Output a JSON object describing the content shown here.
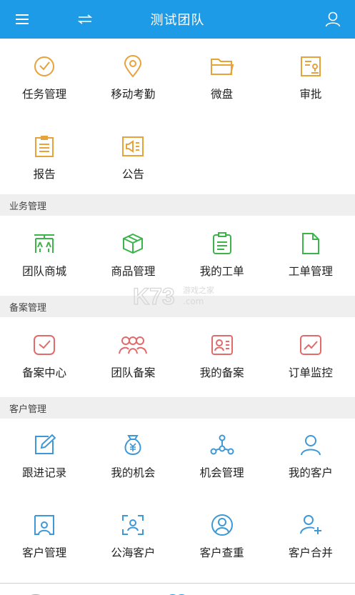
{
  "header": {
    "title": "测试团队"
  },
  "top_items": [
    {
      "label": "任务管理"
    },
    {
      "label": "移动考勤"
    },
    {
      "label": "微盘"
    },
    {
      "label": "审批"
    },
    {
      "label": "报告"
    },
    {
      "label": "公告"
    }
  ],
  "sections": [
    {
      "title": "业务管理",
      "items": [
        {
          "label": "团队商城"
        },
        {
          "label": "商品管理"
        },
        {
          "label": "我的工单"
        },
        {
          "label": "工单管理"
        }
      ]
    },
    {
      "title": "备案管理",
      "items": [
        {
          "label": "备案中心"
        },
        {
          "label": "团队备案"
        },
        {
          "label": "我的备案"
        },
        {
          "label": "订单监控"
        }
      ]
    },
    {
      "title": "客户管理",
      "items": [
        {
          "label": "跟进记录"
        },
        {
          "label": "我的机会"
        },
        {
          "label": "机会管理"
        },
        {
          "label": "我的客户"
        },
        {
          "label": "客户管理"
        },
        {
          "label": "公海客户"
        },
        {
          "label": "客户查重"
        },
        {
          "label": "客户合并"
        }
      ]
    }
  ],
  "watermark": {
    "brand": "K73",
    "text": "游戏之家",
    "domain": ".com"
  },
  "colors": {
    "header": "#1e9be6",
    "orange": "#e8a23a",
    "green": "#3bb44a",
    "red": "#e26a6a",
    "blue": "#3f98d6",
    "section_bg": "#efefef"
  }
}
